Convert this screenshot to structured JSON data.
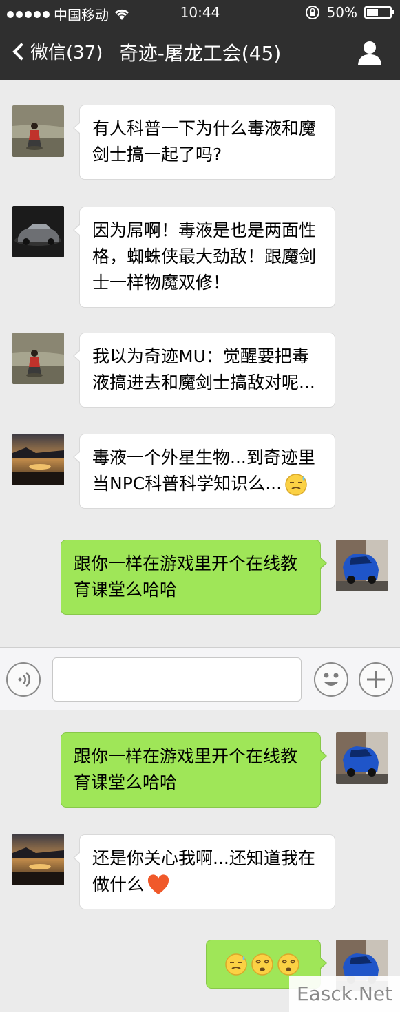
{
  "status_bar": {
    "carrier": "中国移动",
    "time": "10:44",
    "battery": "50%",
    "battery_level": 0.5
  },
  "nav": {
    "back_label": "微信(37)",
    "title": "奇迹-屠龙工会(45)"
  },
  "messages_top": [
    {
      "side": "in",
      "avatar": "child-by-water",
      "lines": [
        "有人科普一下为什么毒液和魔",
        "剑士搞一起了吗?"
      ]
    },
    {
      "side": "in",
      "avatar": "dark-car",
      "lines": [
        "因为屌啊！毒液是也是两面性",
        "格，蜘蛛侠最大劲敌！跟魔剑",
        "士一样物魔双修！"
      ]
    },
    {
      "side": "in",
      "avatar": "child-by-water",
      "lines": [
        "我以为奇迹MU：觉醒要把毒",
        "液搞进去和魔剑士搞敌对呢..."
      ]
    },
    {
      "side": "in",
      "avatar": "sunset",
      "lines": [
        "毒液一个外星生物...到奇迹里",
        "当NPC科普科学知识么..."
      ],
      "emoji": "sweat-smile"
    },
    {
      "side": "out",
      "avatar": "blue-car",
      "lines": [
        "跟你一样在游戏里开个在线教",
        "育课堂么哈哈"
      ]
    }
  ],
  "input_bar": {
    "voice_icon": "voice-icon",
    "emoji_icon": "smiley-icon",
    "plus_icon": "plus-icon"
  },
  "messages_bottom": [
    {
      "side": "out",
      "avatar": "blue-car",
      "lines": [
        "跟你一样在游戏里开个在线教",
        "育课堂么哈哈"
      ]
    },
    {
      "side": "in",
      "avatar": "sunset",
      "lines": [
        "还是你关心我啊...还知道我在",
        "做什么"
      ],
      "emoji": "heart"
    },
    {
      "side": "out",
      "avatar": "blue-car",
      "lines": [],
      "emojis": [
        "sweat-smile",
        "dizzy",
        "dizzy"
      ]
    }
  ],
  "watermark": "Easck.Net",
  "colors": {
    "bar_bg": "#2f2f2f",
    "chat_bg": "#ebebeb",
    "out_bubble": "#9fe658",
    "in_bubble": "#ffffff"
  }
}
